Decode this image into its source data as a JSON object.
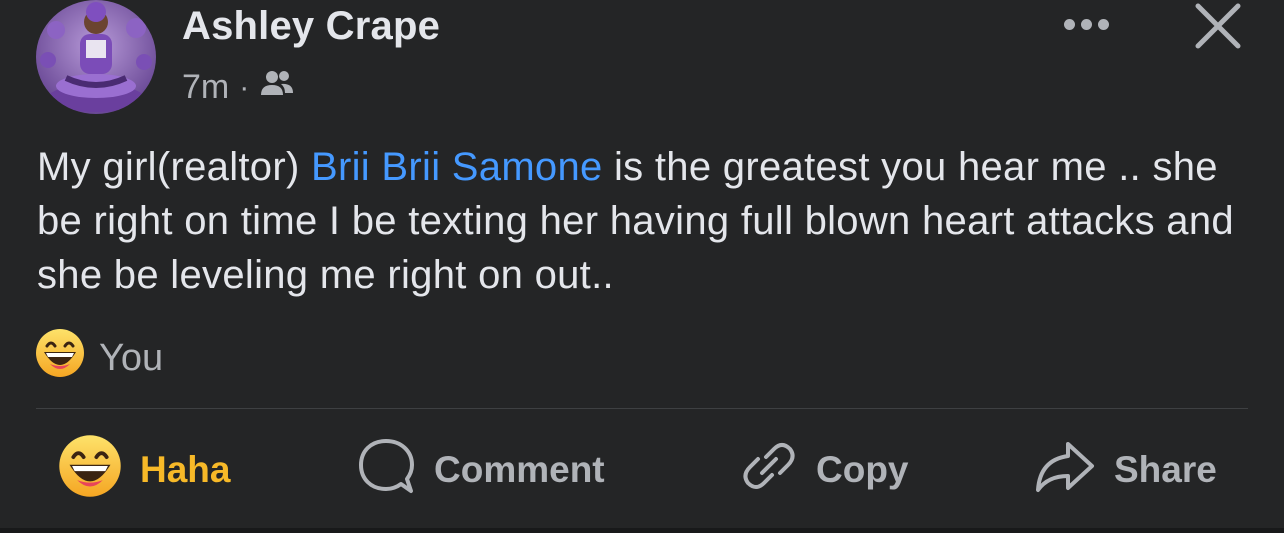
{
  "post": {
    "author": "Ashley Crape",
    "time": "7m",
    "separator": "·",
    "audience_icon": "friends-icon",
    "text_before": "My girl(realtor) ",
    "mention": "Brii Brii Samone",
    "text_after": " is the greatest you hear me .. she be right on time I be texting her having full blown heart attacks and she be leveling me right on out.."
  },
  "reactions": {
    "icon": "haha-emoji-icon",
    "label": "You"
  },
  "actions": {
    "haha": "Haha",
    "comment": "Comment",
    "copy": "Copy",
    "share": "Share"
  },
  "colors": {
    "background": "#242526",
    "text": "#e4e6eb",
    "secondary": "#b0b3b8",
    "mention": "#4599ff",
    "haha_active": "#f7b928"
  }
}
